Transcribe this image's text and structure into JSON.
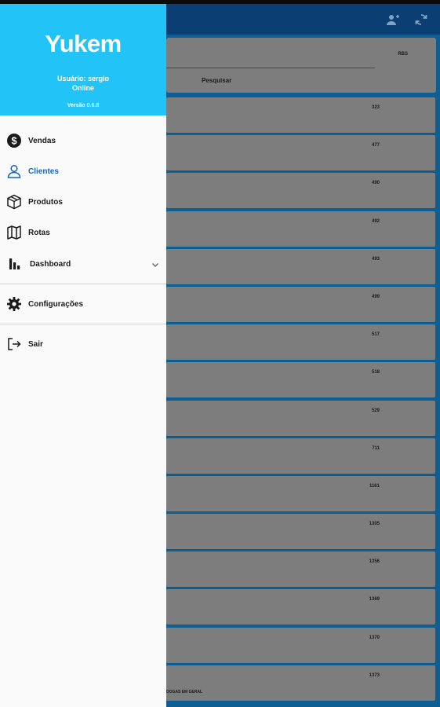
{
  "drawer": {
    "title": "Yukem",
    "user": "Usuário: sergio",
    "status": "Online",
    "version": "Versão 0.6.8",
    "items": [
      {
        "label": "Vendas",
        "icon": "dollar-circle-icon"
      },
      {
        "label": "Clientes",
        "icon": "person-icon",
        "active": true
      },
      {
        "label": "Produtos",
        "icon": "box-icon"
      },
      {
        "label": "Rotas",
        "icon": "map-icon"
      },
      {
        "label": "Dashboard",
        "icon": "bar-chart-icon",
        "expandable": true
      }
    ],
    "settings_label": "Configurações",
    "logout_label": "Sair"
  },
  "appbar": {
    "icons": [
      "add-person-icon",
      "sync-icon"
    ]
  },
  "search": {
    "badge": "RBS",
    "button_label": "Pesquisar"
  },
  "clients": [
    {
      "code": "323",
      "desc": ""
    },
    {
      "code": "477",
      "desc": ""
    },
    {
      "code": "490",
      "desc": ""
    },
    {
      "code": "492",
      "desc": ""
    },
    {
      "code": "493",
      "desc": ""
    },
    {
      "code": "499",
      "desc": ""
    },
    {
      "code": "517",
      "desc": ""
    },
    {
      "code": "518",
      "desc": ""
    },
    {
      "code": "529",
      "desc": ""
    },
    {
      "code": "711",
      "desc": ""
    },
    {
      "code": "1161",
      "desc": ""
    },
    {
      "code": "1305",
      "desc": ""
    },
    {
      "code": "1356",
      "desc": ""
    },
    {
      "code": "1369",
      "desc": ""
    },
    {
      "code": "1370",
      "desc": ""
    },
    {
      "code": "1373",
      "desc": "DOGAS EM GERAL"
    }
  ],
  "colors": {
    "header": "#22c3f7",
    "active": "#1565c0",
    "appbar": "#0b3f73",
    "background": "#0c5e93"
  }
}
